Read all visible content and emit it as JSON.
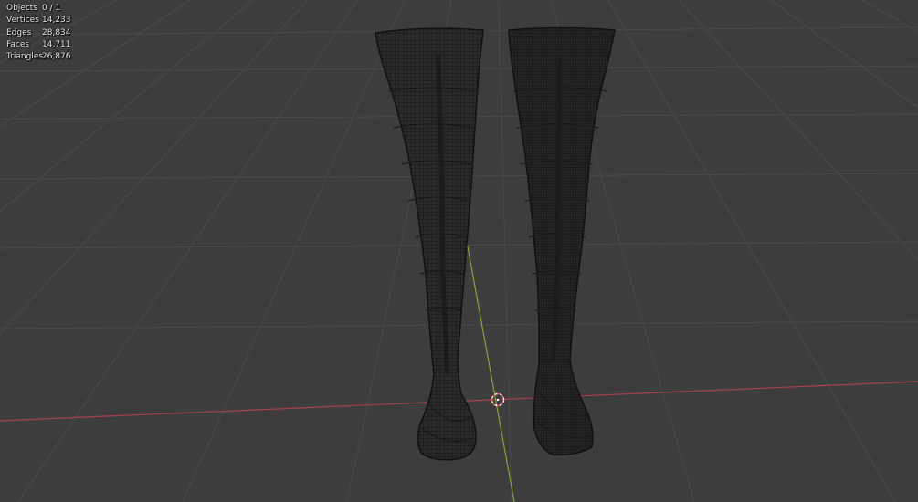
{
  "viewport": {
    "background": "#3d3d3d",
    "grid_color": "#4a4a4a",
    "x_axis_color": "#a8414b",
    "y_axis_color": "#7fa63c",
    "wireframe_color": "#111111",
    "wireframe_fill": "#2b2b2b",
    "cursor_color": "#ffffff",
    "cursor_accent": "#e0525e"
  },
  "stats": {
    "rows": [
      {
        "label": "Objects",
        "value": "0 / 1"
      },
      {
        "label": "Vertices",
        "value": "14,233"
      },
      {
        "label": "Edges",
        "value": "28,834"
      },
      {
        "label": "Faces",
        "value": "14,711"
      },
      {
        "label": "Triangles",
        "value": "26,876"
      }
    ]
  },
  "scene": {
    "object": "stockings-mesh",
    "shading": "wireframe",
    "cursor_icon": "3d-cursor-icon"
  }
}
